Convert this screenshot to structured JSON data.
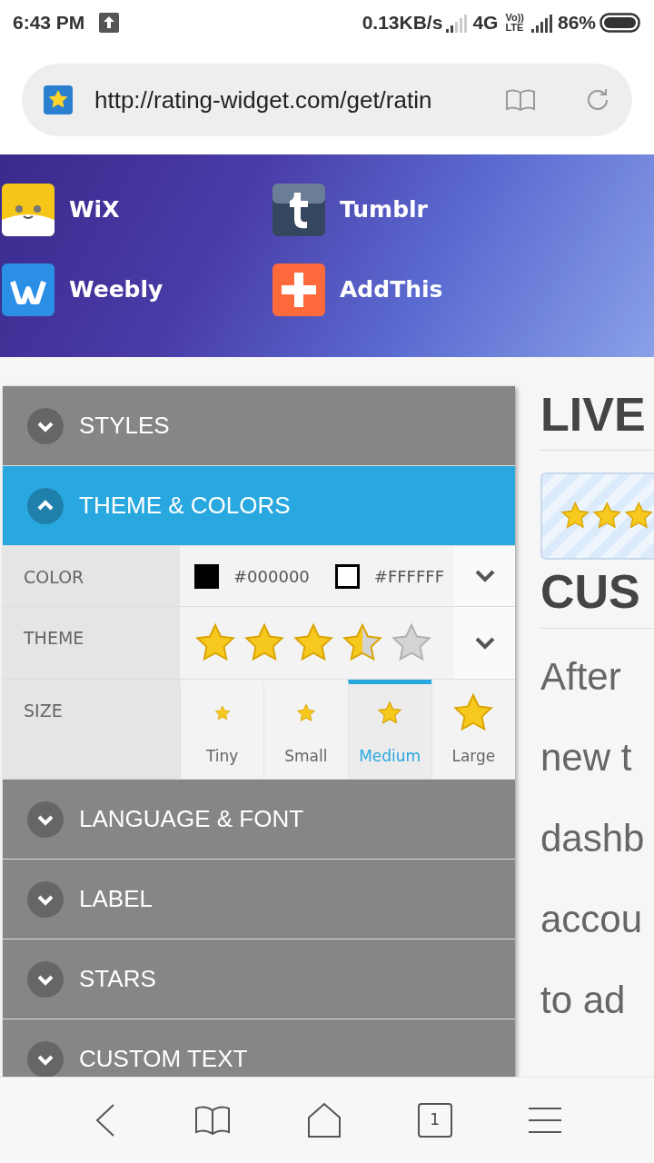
{
  "status_bar": {
    "time": "6:43 PM",
    "speed": "0.13KB/s",
    "network": "4G",
    "volte_top": "Vo))",
    "volte_bottom": "LTE",
    "battery": "86%"
  },
  "address_bar": {
    "url": "http://rating-widget.com/get/ratin"
  },
  "platforms": [
    {
      "name": "WiX",
      "kind": "wix"
    },
    {
      "name": "Tumblr",
      "kind": "tumblr"
    },
    {
      "name": "Weebly",
      "kind": "weebly"
    },
    {
      "name": "AddThis",
      "kind": "addthis"
    }
  ],
  "settings": [
    {
      "title": "STYLES",
      "expanded": false
    },
    {
      "title": "THEME & COLORS",
      "expanded": true,
      "rows": [
        {
          "kind": "color",
          "label": "COLOR",
          "colors": [
            {
              "color": "#000000",
              "value": "#000000"
            },
            {
              "color": "#ffffff",
              "value": "#FFFFFF"
            }
          ]
        },
        {
          "kind": "theme",
          "label": "THEME",
          "stars": 3.5
        },
        {
          "kind": "size",
          "label": "SIZE",
          "options": [
            {
              "label": "Tiny",
              "selected": false
            },
            {
              "label": "Small",
              "selected": false
            },
            {
              "label": "Medium",
              "selected": true
            },
            {
              "label": "Large",
              "selected": false
            }
          ]
        }
      ]
    },
    {
      "title": "LANGUAGE & FONT",
      "expanded": false
    },
    {
      "title": "LABEL",
      "expanded": false
    },
    {
      "title": "STARS",
      "expanded": false
    },
    {
      "title": "CUSTOM TEXT",
      "expanded": false
    }
  ],
  "content": {
    "heading": "LIVE",
    "subheading": "CUS",
    "lines": [
      "After",
      "new t",
      "dashb",
      "accou",
      "to ad"
    ]
  },
  "bottom_nav": {
    "tab_count": "1"
  }
}
